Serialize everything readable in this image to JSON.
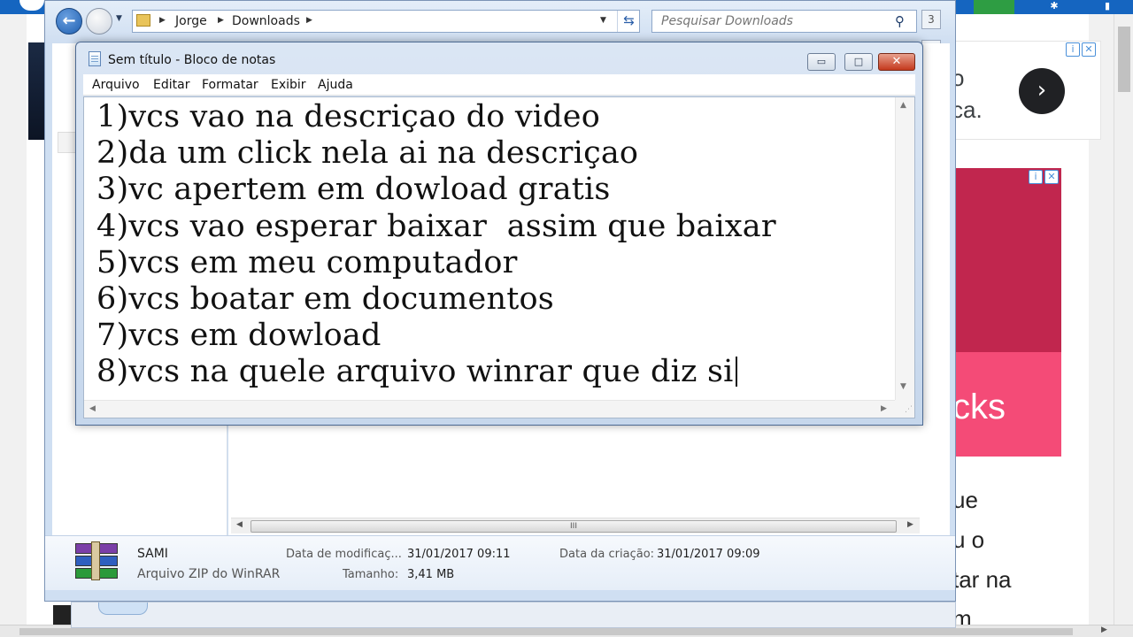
{
  "notepad": {
    "title": "Sem título - Bloco de notas",
    "menu": [
      "Arquivo",
      "Editar",
      "Formatar",
      "Exibir",
      "Ajuda"
    ],
    "window_buttons": {
      "minimize": "▭",
      "maximize": "□",
      "close": "✕"
    },
    "lines": [
      "1)vcs vao na descriçao do video",
      "2)da um click nela ai na descriçao",
      "3)vc apertem em dowload gratis",
      "4)vcs vao esperar baixar  assim que baixar",
      "5)vcs em meu computador",
      "6)vcs boatar em documentos",
      "7)vcs em dowload",
      "8)vcs na quele arquivo winrar que diz si"
    ]
  },
  "explorer": {
    "breadcrumb": [
      "Jorge",
      "Downloads"
    ],
    "search": {
      "placeholder": "Pesquisar Downloads"
    },
    "details": {
      "file_name": "SAMI",
      "file_type": "Arquivo ZIP do WinRAR",
      "modified_label": "Data de modificaç...",
      "modified_value": "31/01/2017 09:11",
      "created_label": "Data da criação:",
      "created_value": "31/01/2017 09:09",
      "size_label": "Tamanho:",
      "size_value": "3,41 MB"
    }
  },
  "background_page": {
    "ad_top_fragments": [
      "o",
      "ca."
    ],
    "ad_banner_fragment": "cks",
    "text_fragments": [
      "ue",
      "u o",
      "tar na",
      "m"
    ]
  },
  "colors": {
    "browser_bar": "#1565c0",
    "ad_red": "#c1264e",
    "ad_pink": "#f44b77",
    "explorer_chrome": "#cfdff2"
  },
  "icons": {
    "back": "back-arrow-icon",
    "forward": "forward-arrow-icon",
    "search": "search-icon",
    "refresh": "refresh-icon",
    "file": "winrar-archive-icon",
    "notepad": "notepad-icon"
  }
}
